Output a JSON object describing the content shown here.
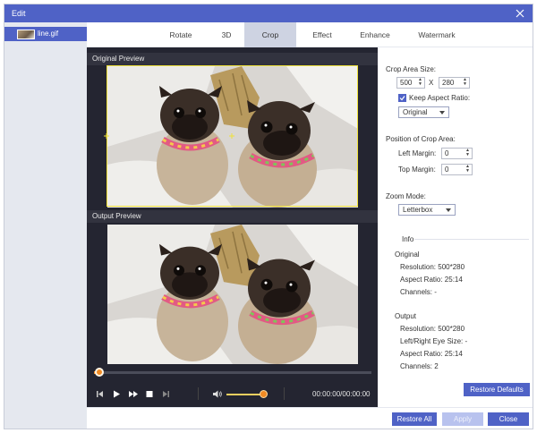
{
  "window": {
    "title": "Edit"
  },
  "sidebar": {
    "file_name": "line.gif"
  },
  "tabs": [
    {
      "label": "Rotate"
    },
    {
      "label": "3D"
    },
    {
      "label": "Crop",
      "active": true
    },
    {
      "label": "Effect"
    },
    {
      "label": "Enhance"
    },
    {
      "label": "Watermark"
    }
  ],
  "preview": {
    "original_label": "Original Preview",
    "output_label": "Output Preview",
    "timecode": "00:00:00/00:00:00",
    "progress": 0,
    "volume": 1.0
  },
  "crop": {
    "area_size_label": "Crop Area Size:",
    "width": "500",
    "separator": "X",
    "height": "280",
    "keep_aspect_label": "Keep Aspect Ratio:",
    "keep_aspect_checked": true,
    "aspect_option": "Original",
    "position_label": "Position of Crop Area:",
    "left_margin_label": "Left Margin:",
    "left_margin": "0",
    "top_margin_label": "Top Margin:",
    "top_margin": "0",
    "zoom_mode_label": "Zoom Mode:",
    "zoom_mode": "Letterbox"
  },
  "info": {
    "header": "Info",
    "original": {
      "title": "Original",
      "resolution": "Resolution: 500*280",
      "aspect_ratio": "Aspect Ratio: 25:14",
      "channels": "Channels: -"
    },
    "output": {
      "title": "Output",
      "resolution": "Resolution: 500*280",
      "eye_size": "Left/Right Eye Size: -",
      "aspect_ratio": "Aspect Ratio: 25:14",
      "channels": "Channels: 2"
    }
  },
  "buttons": {
    "restore_defaults": "Restore Defaults",
    "restore_all": "Restore All",
    "apply": "Apply",
    "close": "Close"
  },
  "icons": [
    "close-icon",
    "checkbox-check-icon",
    "skip-back-icon",
    "play-icon",
    "fast-forward-icon",
    "stop-icon",
    "skip-end-icon",
    "volume-icon"
  ],
  "colors": {
    "accent": "#4f62c6",
    "crop_frame": "#f0e23a",
    "playhead": "#f08a24",
    "preview_bg": "#242531"
  }
}
